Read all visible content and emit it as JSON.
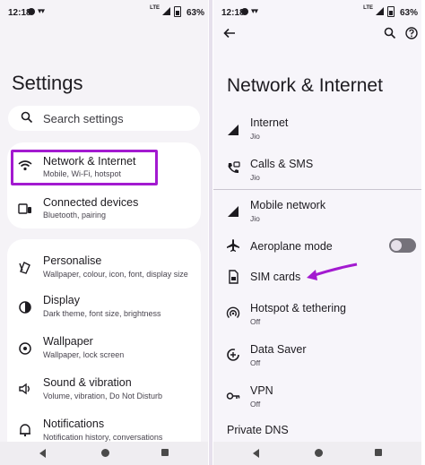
{
  "status_bar": {
    "time": "12:18",
    "network_type": "LTE",
    "battery": "63%"
  },
  "left": {
    "title": "Settings",
    "search": {
      "placeholder": "Search settings"
    },
    "groups": [
      {
        "items": [
          {
            "title": "Network & Internet",
            "subtitle": "Mobile, Wi-Fi, hotspot",
            "icon": "wifi-icon"
          },
          {
            "title": "Connected devices",
            "subtitle": "Bluetooth, pairing",
            "icon": "devices-icon"
          }
        ]
      },
      {
        "items": [
          {
            "title": "Personalise",
            "subtitle": "Wallpaper, colour, icon, font, display size",
            "icon": "personalise-icon"
          },
          {
            "title": "Display",
            "subtitle": "Dark theme, font size, brightness",
            "icon": "display-icon"
          },
          {
            "title": "Wallpaper",
            "subtitle": "Wallpaper, lock screen",
            "icon": "wallpaper-icon"
          },
          {
            "title": "Sound & vibration",
            "subtitle": "Volume, vibration, Do Not Disturb",
            "icon": "sound-icon"
          },
          {
            "title": "Notifications",
            "subtitle": "Notification history, conversations",
            "icon": "bell-icon"
          }
        ]
      }
    ]
  },
  "right": {
    "title": "Network & Internet",
    "items": [
      {
        "title": "Internet",
        "subtitle": "Jio",
        "icon": "signal-icon"
      },
      {
        "title": "Calls & SMS",
        "subtitle": "Jio",
        "icon": "calls-sms-icon"
      },
      {
        "title": "Mobile network",
        "subtitle": "Jio",
        "icon": "signal-icon"
      },
      {
        "title": "Aeroplane mode",
        "subtitle": "",
        "icon": "airplane-icon",
        "toggle": "off"
      },
      {
        "title": "SIM cards",
        "subtitle": "",
        "icon": "sim-icon"
      },
      {
        "title": "Hotspot & tethering",
        "subtitle": "Off",
        "icon": "hotspot-icon"
      },
      {
        "title": "Data Saver",
        "subtitle": "Off",
        "icon": "data-saver-icon"
      },
      {
        "title": "VPN",
        "subtitle": "Off",
        "icon": "vpn-icon"
      }
    ],
    "private_dns": "Private DNS"
  },
  "colors": {
    "highlight": "#a31ad0",
    "arrow": "#a31ad0"
  }
}
